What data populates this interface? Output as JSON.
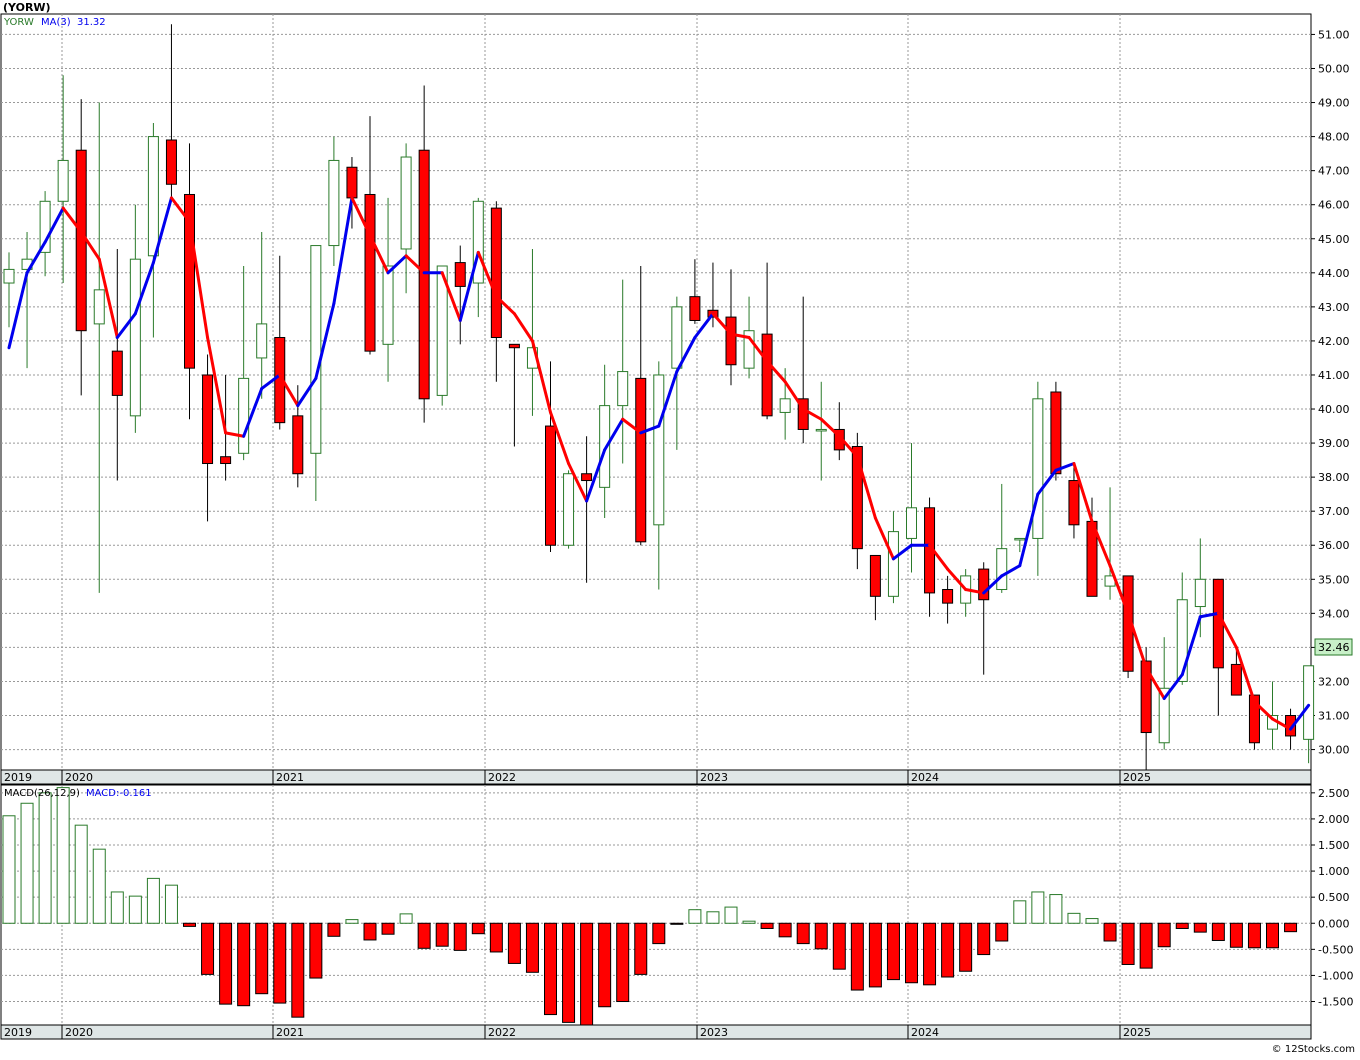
{
  "title": "(YORW)",
  "watermark": "© 12Stocks.com",
  "colors": {
    "up": "#2a7a2a",
    "down": "#ff0000",
    "ma": "#0000ee",
    "ma_down": "#ff0000",
    "grid": "#999999",
    "axis_band": "#dfe6e6",
    "last_price_bg": "#c8f0c8"
  },
  "price_panel": {
    "legend": {
      "symbol": "YORW",
      "ma_label": "MA(3)",
      "ma_value": "31.32"
    },
    "last_price": "32.46"
  },
  "macd_panel": {
    "legend": {
      "label": "MACD(26,12,9)",
      "value_label": "MACD:-0.161"
    }
  },
  "x_labels": [
    "2019",
    "2020",
    "2021",
    "2022",
    "2023",
    "2024",
    "2025"
  ],
  "chart_data": [
    {
      "type": "candlestick",
      "period": "monthly",
      "symbol": "YORW",
      "ylim": [
        29.4,
        51.6
      ],
      "y_ticks": [
        "30.00",
        "31.00",
        "32.00",
        "33.00",
        "34.00",
        "35.00",
        "36.00",
        "37.00",
        "38.00",
        "39.00",
        "40.00",
        "41.00",
        "42.00",
        "43.00",
        "44.00",
        "45.00",
        "46.00",
        "47.00",
        "48.00",
        "49.00",
        "50.00",
        "51.00"
      ],
      "candles": [
        {
          "o": 43.7,
          "h": 44.6,
          "l": 42.4,
          "c": 44.1
        },
        {
          "o": 44.1,
          "h": 45.2,
          "l": 41.2,
          "c": 44.4
        },
        {
          "o": 44.6,
          "h": 46.4,
          "l": 43.9,
          "c": 46.1
        },
        {
          "o": 46.1,
          "h": 49.8,
          "l": 43.7,
          "c": 47.3
        },
        {
          "o": 47.6,
          "h": 49.1,
          "l": 40.4,
          "c": 42.3
        },
        {
          "o": 42.5,
          "h": 49.0,
          "l": 34.6,
          "c": 43.5
        },
        {
          "o": 41.7,
          "h": 44.7,
          "l": 37.9,
          "c": 40.4
        },
        {
          "o": 39.8,
          "h": 46.0,
          "l": 39.3,
          "c": 44.4
        },
        {
          "o": 44.5,
          "h": 48.4,
          "l": 42.1,
          "c": 48.0
        },
        {
          "o": 47.9,
          "h": 51.3,
          "l": 46.2,
          "c": 46.6
        },
        {
          "o": 46.3,
          "h": 47.8,
          "l": 39.7,
          "c": 41.2
        },
        {
          "o": 41.0,
          "h": 41.6,
          "l": 36.7,
          "c": 38.4
        },
        {
          "o": 38.6,
          "h": 41.0,
          "l": 37.9,
          "c": 38.4
        },
        {
          "o": 38.7,
          "h": 44.2,
          "l": 38.5,
          "c": 40.9
        },
        {
          "o": 41.5,
          "h": 45.2,
          "l": 40.3,
          "c": 42.5
        },
        {
          "o": 42.1,
          "h": 44.5,
          "l": 39.4,
          "c": 39.6
        },
        {
          "o": 39.8,
          "h": 40.7,
          "l": 37.7,
          "c": 38.1
        },
        {
          "o": 38.7,
          "h": 43.2,
          "l": 37.3,
          "c": 44.8
        },
        {
          "o": 44.8,
          "h": 48.0,
          "l": 44.2,
          "c": 47.3
        },
        {
          "o": 47.1,
          "h": 47.4,
          "l": 45.3,
          "c": 46.2
        },
        {
          "o": 46.3,
          "h": 48.6,
          "l": 41.6,
          "c": 41.7
        },
        {
          "o": 41.9,
          "h": 46.2,
          "l": 40.8,
          "c": 44.2
        },
        {
          "o": 44.7,
          "h": 47.8,
          "l": 43.4,
          "c": 47.4
        },
        {
          "o": 47.6,
          "h": 49.5,
          "l": 39.6,
          "c": 40.3
        },
        {
          "o": 40.4,
          "h": 44.2,
          "l": 40.1,
          "c": 44.2
        },
        {
          "o": 44.3,
          "h": 44.8,
          "l": 41.9,
          "c": 43.6
        },
        {
          "o": 43.7,
          "h": 46.2,
          "l": 42.7,
          "c": 46.1
        },
        {
          "o": 45.9,
          "h": 46.1,
          "l": 40.8,
          "c": 42.1
        },
        {
          "o": 41.9,
          "h": 41.9,
          "l": 38.9,
          "c": 41.8
        },
        {
          "o": 41.2,
          "h": 44.7,
          "l": 39.8,
          "c": 41.8
        },
        {
          "o": 39.5,
          "h": 41.4,
          "l": 35.8,
          "c": 36.0
        },
        {
          "o": 36.0,
          "h": 38.2,
          "l": 35.9,
          "c": 38.1
        },
        {
          "o": 38.1,
          "h": 39.2,
          "l": 34.9,
          "c": 37.9
        },
        {
          "o": 37.7,
          "h": 41.3,
          "l": 36.8,
          "c": 40.1
        },
        {
          "o": 40.1,
          "h": 43.8,
          "l": 38.4,
          "c": 41.1
        },
        {
          "o": 40.9,
          "h": 44.2,
          "l": 36.0,
          "c": 36.1
        },
        {
          "o": 36.6,
          "h": 41.4,
          "l": 34.7,
          "c": 41.0
        },
        {
          "o": 41.2,
          "h": 43.3,
          "l": 38.8,
          "c": 43.0
        },
        {
          "o": 43.3,
          "h": 44.4,
          "l": 42.5,
          "c": 42.6
        },
        {
          "o": 42.9,
          "h": 44.3,
          "l": 42.4,
          "c": 42.7
        },
        {
          "o": 42.7,
          "h": 44.1,
          "l": 40.7,
          "c": 41.3
        },
        {
          "o": 41.2,
          "h": 43.3,
          "l": 40.9,
          "c": 42.3
        },
        {
          "o": 42.2,
          "h": 44.3,
          "l": 39.7,
          "c": 39.8
        },
        {
          "o": 39.9,
          "h": 41.2,
          "l": 39.1,
          "c": 40.3
        },
        {
          "o": 40.3,
          "h": 43.3,
          "l": 39.0,
          "c": 39.4
        },
        {
          "o": 39.4,
          "h": 40.8,
          "l": 37.9,
          "c": 39.4
        },
        {
          "o": 39.4,
          "h": 40.2,
          "l": 38.5,
          "c": 38.8
        },
        {
          "o": 38.9,
          "h": 39.3,
          "l": 35.3,
          "c": 35.9
        },
        {
          "o": 35.7,
          "h": 35.7,
          "l": 33.8,
          "c": 34.5
        },
        {
          "o": 34.5,
          "h": 37.0,
          "l": 34.3,
          "c": 36.4
        },
        {
          "o": 36.2,
          "h": 39.0,
          "l": 35.2,
          "c": 37.1
        },
        {
          "o": 37.1,
          "h": 37.4,
          "l": 33.9,
          "c": 34.6
        },
        {
          "o": 34.7,
          "h": 35.1,
          "l": 33.7,
          "c": 34.3
        },
        {
          "o": 34.3,
          "h": 35.3,
          "l": 33.9,
          "c": 35.1
        },
        {
          "o": 35.3,
          "h": 35.5,
          "l": 32.2,
          "c": 34.4
        },
        {
          "o": 34.7,
          "h": 37.8,
          "l": 34.6,
          "c": 35.9
        },
        {
          "o": 36.2,
          "h": 36.2,
          "l": 35.8,
          "c": 36.2
        },
        {
          "o": 36.2,
          "h": 40.8,
          "l": 35.1,
          "c": 40.3
        },
        {
          "o": 40.5,
          "h": 40.8,
          "l": 37.9,
          "c": 38.1
        },
        {
          "o": 37.9,
          "h": 38.4,
          "l": 36.2,
          "c": 36.6
        },
        {
          "o": 36.7,
          "h": 37.4,
          "l": 34.5,
          "c": 34.5
        },
        {
          "o": 34.8,
          "h": 37.7,
          "l": 34.4,
          "c": 35.1
        },
        {
          "o": 35.1,
          "h": 35.1,
          "l": 32.1,
          "c": 32.3
        },
        {
          "o": 32.6,
          "h": 33.0,
          "l": 29.4,
          "c": 30.5
        },
        {
          "o": 30.2,
          "h": 33.3,
          "l": 30.0,
          "c": 31.8
        },
        {
          "o": 32.0,
          "h": 35.2,
          "l": 31.9,
          "c": 34.4
        },
        {
          "o": 34.2,
          "h": 36.2,
          "l": 33.3,
          "c": 35.0
        },
        {
          "o": 35.0,
          "h": 35.0,
          "l": 31.0,
          "c": 32.4
        },
        {
          "o": 32.5,
          "h": 33.0,
          "l": 31.6,
          "c": 31.6
        },
        {
          "o": 31.6,
          "h": 31.6,
          "l": 30.0,
          "c": 30.2
        },
        {
          "o": 30.6,
          "h": 32.0,
          "l": 30.0,
          "c": 31.0
        },
        {
          "o": 31.0,
          "h": 31.2,
          "l": 30.0,
          "c": 30.4
        },
        {
          "o": 30.3,
          "h": 32.4,
          "l": 29.6,
          "c": 32.46
        }
      ],
      "ma3": [
        41.8,
        44.0,
        44.9,
        45.9,
        45.2,
        44.4,
        42.1,
        42.8,
        44.3,
        46.2,
        45.5,
        42.1,
        39.3,
        39.2,
        40.6,
        41.0,
        40.1,
        40.9,
        43.1,
        46.2,
        45.1,
        44.0,
        44.5,
        44.0,
        44.0,
        42.6,
        44.6,
        43.3,
        42.8,
        42.0,
        39.9,
        38.4,
        37.3,
        38.8,
        39.7,
        39.3,
        39.5,
        41.1,
        42.1,
        42.8,
        42.2,
        42.1,
        41.4,
        40.8,
        40.0,
        39.7,
        39.2,
        38.6,
        36.8,
        35.6,
        36.0,
        36.0,
        35.3,
        34.7,
        34.6,
        35.1,
        35.4,
        37.5,
        38.2,
        38.4,
        36.7,
        35.4,
        34.0,
        32.4,
        31.5,
        32.2,
        33.9,
        34.0,
        33.0,
        31.4,
        30.9,
        30.6,
        31.3
      ]
    },
    {
      "type": "bar",
      "name": "MACD(26,12,9)",
      "ylim": [
        -1.95,
        2.65
      ],
      "y_ticks": [
        "2.500",
        "2.000",
        "1.500",
        "1.000",
        "0.500",
        "0.000",
        "-0.500",
        "-1.000",
        "-1.500"
      ],
      "values": [
        2.06,
        2.3,
        2.5,
        2.6,
        1.88,
        1.42,
        0.6,
        0.52,
        0.86,
        0.73,
        -0.06,
        -0.98,
        -1.55,
        -1.58,
        -1.35,
        -1.53,
        -1.8,
        -1.05,
        -0.25,
        0.07,
        -0.32,
        -0.21,
        0.18,
        -0.48,
        -0.44,
        -0.52,
        -0.2,
        -0.55,
        -0.77,
        -0.94,
        -1.75,
        -1.9,
        -1.95,
        -1.6,
        -1.5,
        -0.98,
        -0.39,
        -0.02,
        0.26,
        0.22,
        0.31,
        0.04,
        -0.1,
        -0.26,
        -0.39,
        -0.49,
        -0.88,
        -1.28,
        -1.22,
        -1.08,
        -1.14,
        -1.18,
        -1.03,
        -0.92,
        -0.6,
        -0.34,
        0.43,
        0.6,
        0.55,
        0.19,
        0.09,
        -0.34,
        -0.79,
        -0.86,
        -0.45,
        -0.1,
        -0.17,
        -0.33,
        -0.46,
        -0.47,
        -0.47,
        -0.161
      ]
    }
  ]
}
